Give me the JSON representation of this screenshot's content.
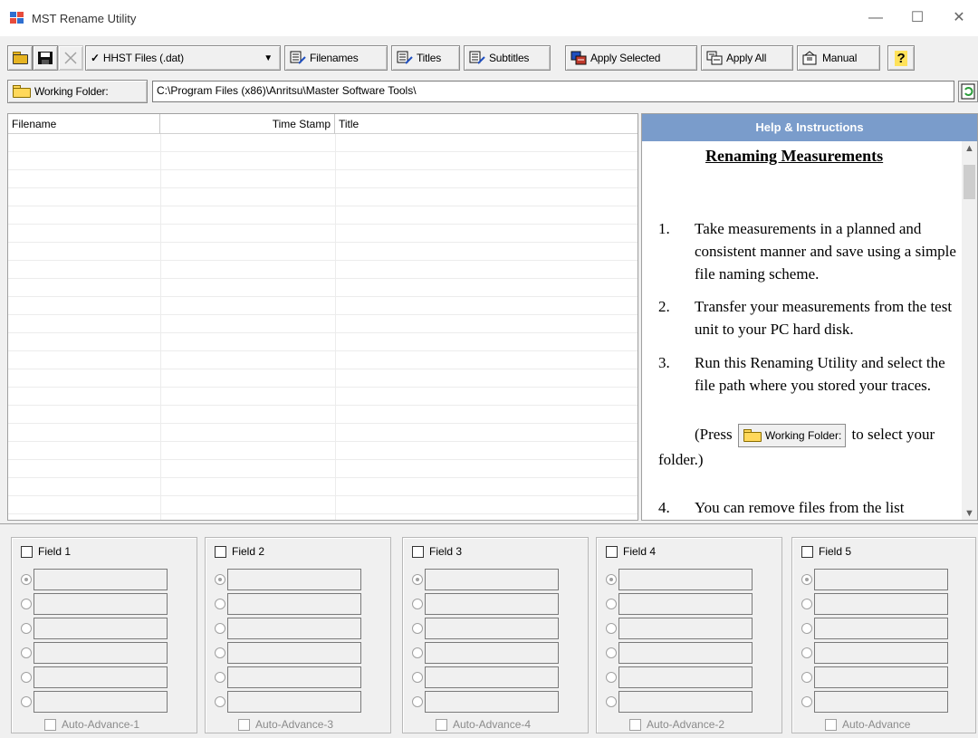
{
  "window": {
    "title": "MST Rename Utility",
    "minimize": "—",
    "maximize": "☐",
    "close": "✕"
  },
  "toolbar": {
    "file_type": "HHST Files (.dat)",
    "filenames": "Filenames",
    "titles": "Titles",
    "subtitles": "Subtitles",
    "apply_selected": "Apply Selected",
    "apply_all": "Apply All",
    "manual": "Manual",
    "checkmark": "✓",
    "dropdown": "▼",
    "help_glyph": "?"
  },
  "folder": {
    "button": "Working Folder:",
    "path": "C:\\Program Files (x86)\\Anritsu\\Master Software Tools\\"
  },
  "list": {
    "columns": [
      "Filename",
      "Time Stamp",
      "Title"
    ]
  },
  "help": {
    "header": "Help & Instructions",
    "title": "Renaming Measurements",
    "steps": [
      {
        "n": "1.",
        "text": "Take measurements in a planned and consistent manner and save using a simple file naming scheme."
      },
      {
        "n": "2.",
        "text": "Transfer your measurements from the test unit to your PC hard disk."
      },
      {
        "n": "3.",
        "text": "Run this Renaming Utility and select the file path where you stored your traces."
      },
      {
        "n": "4.",
        "text": "You can remove files from the list"
      }
    ],
    "press_pre": "(Press",
    "press_btn": "Working Folder:",
    "press_post": "to select your folder.)"
  },
  "fields": [
    {
      "label": "Field 1",
      "auto": "Auto-Advance-1"
    },
    {
      "label": "Field 2",
      "auto": "Auto-Advance-3"
    },
    {
      "label": "Field 3",
      "auto": "Auto-Advance-4"
    },
    {
      "label": "Field 4",
      "auto": "Auto-Advance-2"
    },
    {
      "label": "Field 5",
      "auto": "Auto-Advance"
    }
  ]
}
